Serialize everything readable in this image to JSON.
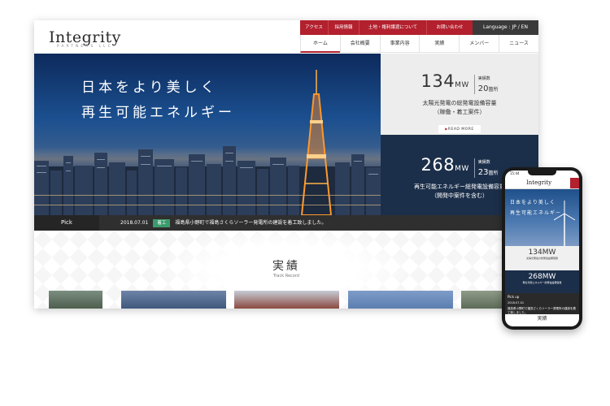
{
  "desktop": {
    "logo": {
      "name": "Integrity",
      "sub": "PARTNERS LLC"
    },
    "util_nav": [
      "アクセス",
      "採用情報",
      "土地・権利譲渡について",
      "お問い合わせ"
    ],
    "language": "Language : JP / EN",
    "main_nav": [
      "ホーム",
      "会社概要",
      "事業内容",
      "実績",
      "メンバー",
      "ニュース"
    ],
    "hero": {
      "line1": "日本をより美しく",
      "line2": "再生可能エネルギー"
    },
    "stat1": {
      "value": "134",
      "unit": "MW",
      "count_label": "実績数",
      "count_value": "20",
      "count_unit": "箇所",
      "desc1": "太陽光発電の総発電設備容量",
      "desc2": "（稼働・着工案件）",
      "read_more": "READ MORE"
    },
    "stat2": {
      "value": "268",
      "unit": "MW",
      "count_label": "実績数",
      "count_value": "23",
      "count_unit": "箇所",
      "desc1": "再生可能エネルギー総発電設備容量",
      "desc2": "（開発中案件を含む）"
    },
    "pick": {
      "label": "Pick",
      "date": "2018.07.01",
      "badge": "着工",
      "text": "福島県小野町で福島さくらソーラー発電所の建設を着工致しました。"
    },
    "track": {
      "title": "実績",
      "subtitle": "Track Record"
    }
  },
  "phone": {
    "time": "15:44",
    "logo": "Integrity",
    "hero": {
      "line1": "日本をより美しく",
      "line2": "再生可能エネルギー"
    },
    "stat1": "134MW",
    "stat2": "268MW",
    "pick_label": "Pick up",
    "pick_date": "2018.07.01",
    "pick_text": "福島県小野町で福島さくらソーラー発電所の建設を着工致しました。",
    "track_title": "実績"
  },
  "colors": {
    "accent": "#b3202e",
    "navy": "#1c2f4a",
    "badge_green": "#3c9b6d"
  }
}
